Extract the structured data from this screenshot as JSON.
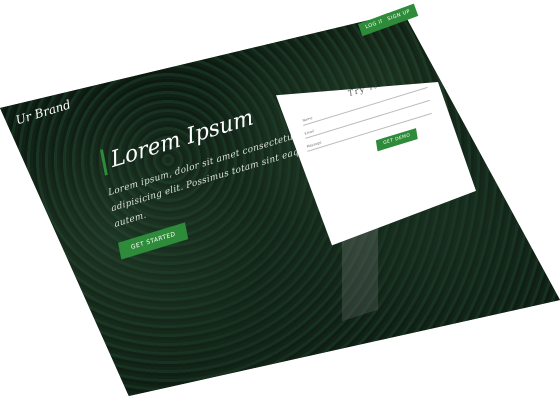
{
  "brand": {
    "name": "Ur Brand"
  },
  "nav": {
    "items": [
      {
        "label": "LOG IN"
      },
      {
        "label": "SIGN UP"
      }
    ]
  },
  "hero": {
    "title": "Lorem Ipsum",
    "text": "Lorem ipsum, dolor sit amet consectetur adipisicing elit. Possimus totam sint eaque autem.",
    "cta_label": "GET STARTED"
  },
  "form": {
    "title": "Try it Out",
    "fields": [
      {
        "label": "Name",
        "placeholder": ""
      },
      {
        "label": "Email",
        "placeholder": ""
      },
      {
        "label": "Message",
        "placeholder": ""
      }
    ],
    "submit_label": "GET DEMO"
  },
  "colors": {
    "accent": "#2e8b3a",
    "background": "#0e1a12",
    "card": "#ffffff"
  }
}
